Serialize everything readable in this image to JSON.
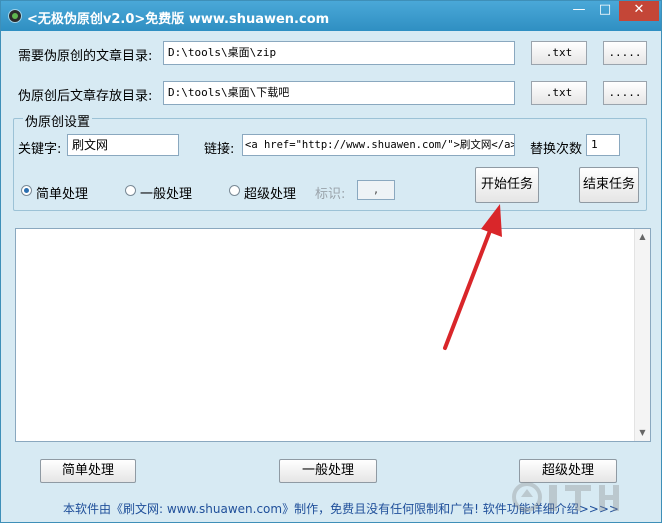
{
  "window": {
    "title": "<无极伪原创v2.0>免费版 www.shuawen.com"
  },
  "source_dir": {
    "label": "需要伪原创的文章目录:",
    "value": "D:\\tools\\桌面\\zip",
    "ext_button": ".txt",
    "browse_button": "....."
  },
  "target_dir": {
    "label": "伪原创后文章存放目录:",
    "value": "D:\\tools\\桌面\\下载吧",
    "ext_button": ".txt",
    "browse_button": "....."
  },
  "settings": {
    "group_title": "伪原创设置",
    "keyword_label": "关键字:",
    "keyword_value": "刷文网",
    "link_label": "链接:",
    "link_value": "<a href=\"http://www.shuawen.com/\">刷文网</a>",
    "replace_label": "替换次数",
    "replace_value": "1",
    "modes": [
      {
        "label": "简单处理",
        "selected": true
      },
      {
        "label": "一般处理",
        "selected": false
      },
      {
        "label": "超级处理",
        "selected": false
      }
    ],
    "marker_label": "标识:",
    "marker_value": ",",
    "start_button": "开始任务",
    "stop_button": "结束任务"
  },
  "bottom_buttons": {
    "simple": "简单处理",
    "normal": "一般处理",
    "super": "超级处理"
  },
  "footer": {
    "text": "本软件由《刷文网: www.shuawen.com》制作，免费且没有任何限制和广告! 软件功能详细介绍>>>>"
  },
  "colors": {
    "titlebar": "#3a9bd0",
    "background": "#d7eaf3",
    "arrow": "#d9262a",
    "footer_link": "#1f4f9a"
  }
}
